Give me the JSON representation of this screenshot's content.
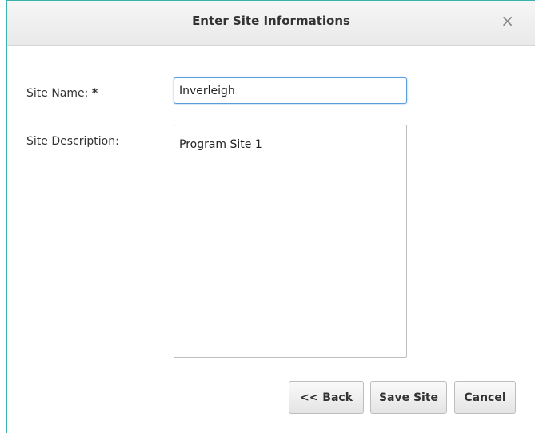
{
  "dialog": {
    "title": "Enter Site Informations",
    "close_glyph": "×"
  },
  "form": {
    "site_name_label": "Site Name:",
    "required_marker": "*",
    "site_name_value": "Inverleigh",
    "site_description_label": "Site Description:",
    "site_description_value": "Program Site 1"
  },
  "buttons": {
    "back": "<< Back",
    "save": "Save Site",
    "cancel": "Cancel"
  }
}
